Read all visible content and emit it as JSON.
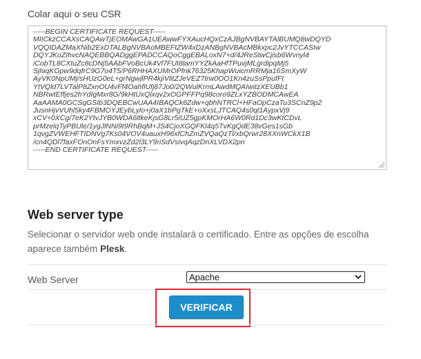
{
  "csr": {
    "label": "Colar aqui o seu CSR",
    "value": "-----BEGIN CERTIFICATE REQUEST-----\nMIICkzCCAXsCAQAwTjEOMAwGA1UEAwwFYXAucHQxCzAJBgNVBAYTAlBUMQ8wDQYD\nVQQIDAZMaXNib2ExDTALBgNVBAoMBEFtZW4xDzANBgNVBAcMBkxpc2JvYTCCASIw\nDQYJKoZIhvcNAQEBBQADggEPADCCAQoCggEBALoxN7+d/4JReStwCjisb6Wvnyl4\niCobTL8CXtuZc8cDNj5AAbFVoBcUk4Vl7FUt8lamYYZkAaHfTPuvjMLgrdipqMj5\nSjhiqKGpw9dqfrC9G7o4T5/P6RHHAXUMrOPfnk76325KhapWuicmRRMja16SmXyW\nAyVK0NpUMj/sHUzG0eL+grNgwjlPR4kjiVlitZJeVEZ7trw0OO1Kn4zuSsPpufFt\nYtVQld7LVTalP8ZxnOU4vFf4OahflUfj87Jo0/2QWulKrmLAwdMQAIwitzXEUBb1\nNBRwtEffjes2hYdIgMxr8G/9kHtUxQlxqv2xOGPFFPq98coro9ZLxYZBODMCAwEA\nAaAAMA0GCSqGSIb3DQEBCwUAA4IBAQCk6Zdw+qbhNTRCl+HFaOpCzaTu3SCnZ9p2\nJusnHjvVUhl5ky4FBMOYJEybLylo+j0aX1bPgTkE+oXxsLJTCAQ4s0ql1AypxVj9\nxCV+0XCg/7eK2YtvJYB0WDA6ltkeKjsG8Lr5iUZ5gpKMOrHA6W0Rd1Dc3wKtCDvL\nprMzelqTyPBUle/1ygJlNNi9t9RhBqM+JS4CjoXGQFKl4q5TvKgQdE38vGes1sGb\n1qvgZVWEHFTIDNVg7Ks04VOV4uauxH96xfChZmZVQaQzTl/xbQrwr28XXnWCkX1B\n/cn4QDl7faxFOnOnFsYmxvzZd2l3LY9riSdVsivqAqzDnXLVDX2pn\n-----END CERTIFICATE REQUEST-----"
  },
  "web_server": {
    "title": "Web server type",
    "description_prefix": "Selecionar o servidor web onde instalará o certificado. Entre as opções de escolha aparece também ",
    "description_bold": "Plesk",
    "description_suffix": ".",
    "field_label": "Web Server",
    "selected_value": "Apache"
  },
  "actions": {
    "verify_label": "VERIFICAR",
    "highlight_color": "#e0242b",
    "button_color": "#1e8ecb"
  }
}
